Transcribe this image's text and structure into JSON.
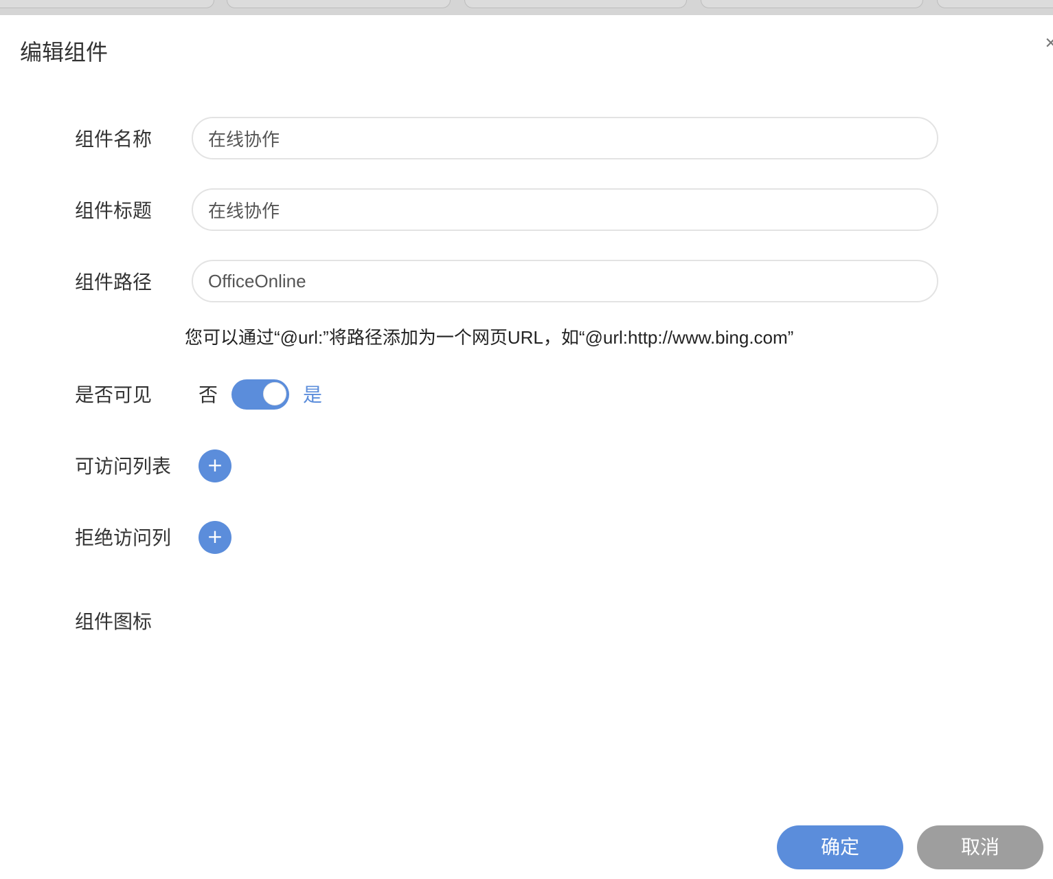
{
  "dialog": {
    "title": "编辑组件",
    "close_icon": "close-icon"
  },
  "form": {
    "name": {
      "label": "组件名称",
      "value": "在线协作"
    },
    "title": {
      "label": "组件标题",
      "value": "在线协作"
    },
    "path": {
      "label": "组件路径",
      "value": "OfficeOnline"
    },
    "path_hint": "您可以通过“@url:”将路径添加为一个网页URL，如“@url:http://www.bing.com”",
    "visible": {
      "label": "是否可见",
      "off_label": "否",
      "on_label": "是",
      "value": true
    },
    "allow_list": {
      "label": "可访问列表",
      "add_glyph": "+"
    },
    "deny_list": {
      "label": "拒绝访问列",
      "add_glyph": "+"
    },
    "icon": {
      "label": "组件图标"
    }
  },
  "buttons": {
    "confirm": "确定",
    "cancel": "取消"
  },
  "colors": {
    "primary": "#5b8ddb",
    "cancel": "#9e9e9e",
    "border": "#e3e3e3"
  }
}
